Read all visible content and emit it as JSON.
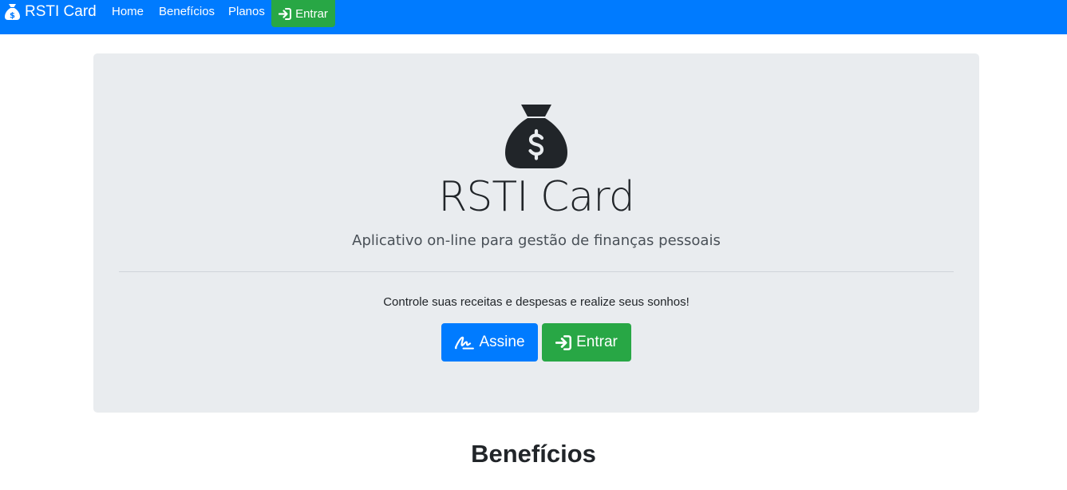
{
  "navbar": {
    "brand_text": "RSTI Card",
    "brand_icon": "money-bag-icon",
    "links": [
      {
        "label": "Home"
      },
      {
        "label": "Benefícios"
      },
      {
        "label": "Planos"
      }
    ],
    "login_label": "Entrar",
    "login_icon": "sign-in-icon"
  },
  "hero": {
    "icon": "money-bag-icon",
    "title": "RSTI Card",
    "lead": "Aplicativo on-line para gestão de finanças pessoais",
    "text": "Controle suas receitas e despesas e realize seus sonhos!",
    "subscribe_label": "Assine",
    "subscribe_icon": "signature-icon",
    "login_label": "Entrar",
    "login_icon": "sign-in-icon"
  },
  "benefits": {
    "title": "Benefícios"
  },
  "colors": {
    "primary": "#007bff",
    "success": "#28a745",
    "jumbotron": "#e9ecef",
    "text": "#212529"
  }
}
